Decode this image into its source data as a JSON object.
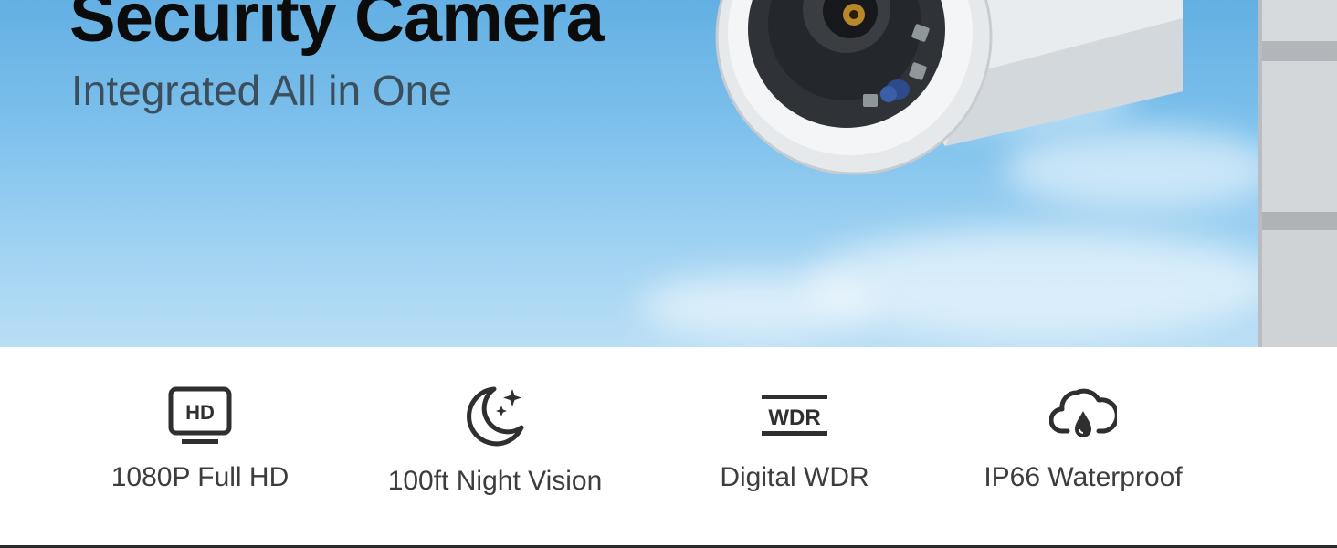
{
  "hero": {
    "headline": "Security Camera",
    "subheadline": "Integrated All in One",
    "background_image": "security-camera-photo"
  },
  "features": [
    {
      "icon": "hd-screen-icon",
      "label": "1080P Full HD",
      "icon_text": "HD"
    },
    {
      "icon": "moon-stars-icon",
      "label": "100ft Night Vision"
    },
    {
      "icon": "wdr-icon",
      "label": "Digital WDR",
      "icon_text": "WDR"
    },
    {
      "icon": "cloud-waterdrop-icon",
      "label": "IP66 Waterproof"
    }
  ],
  "colors": {
    "sky_top": "#63afe3",
    "sky_bottom": "#b9def5",
    "headline": "#0b0b0b",
    "subheadline": "#3c4e5c",
    "feature_icon": "#2f2f2f",
    "feature_text": "#3d3d3d"
  }
}
